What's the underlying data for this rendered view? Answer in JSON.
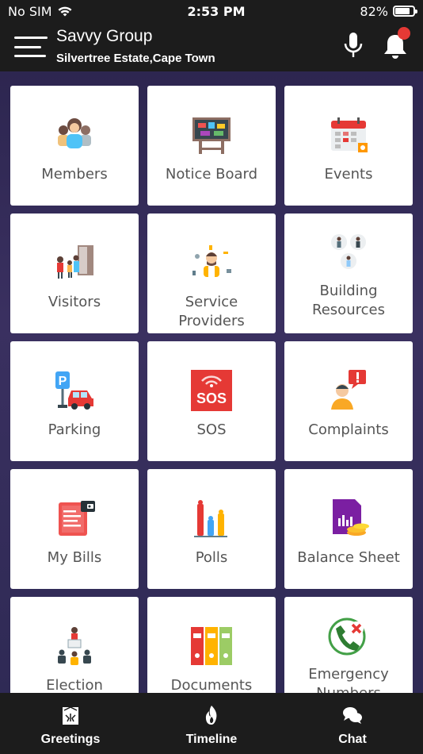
{
  "status_bar": {
    "carrier": "No SIM",
    "time": "2:53 PM",
    "battery_percent": "82%",
    "battery_level": 0.82
  },
  "header": {
    "title": "Savvy Group",
    "subtitle": "Silvertree Estate,Cape Town",
    "notification_badge_color": "#e53935"
  },
  "tiles": [
    {
      "label": "Members",
      "icon": "members-icon"
    },
    {
      "label": "Notice Board",
      "icon": "notice-board-icon"
    },
    {
      "label": "Events",
      "icon": "events-icon"
    },
    {
      "label": "Visitors",
      "icon": "visitors-icon"
    },
    {
      "label": "Service Providers",
      "icon": "service-providers-icon"
    },
    {
      "label": "Building Resources",
      "icon": "building-resources-icon"
    },
    {
      "label": "Parking",
      "icon": "parking-icon"
    },
    {
      "label": "SOS",
      "icon": "sos-icon",
      "icon_text": "SOS"
    },
    {
      "label": "Complaints",
      "icon": "complaints-icon"
    },
    {
      "label": "My Bills",
      "icon": "bills-icon"
    },
    {
      "label": "Polls",
      "icon": "polls-icon"
    },
    {
      "label": "Balance Sheet",
      "icon": "balance-sheet-icon"
    },
    {
      "label": "Election",
      "icon": "election-icon"
    },
    {
      "label": "Documents",
      "icon": "documents-icon"
    },
    {
      "label": "Emergency Numbers",
      "icon": "emergency-numbers-icon"
    }
  ],
  "bottom_nav": [
    {
      "label": "Greetings",
      "icon": "greetings-icon"
    },
    {
      "label": "Timeline",
      "icon": "timeline-icon"
    },
    {
      "label": "Chat",
      "icon": "chat-icon"
    }
  ]
}
